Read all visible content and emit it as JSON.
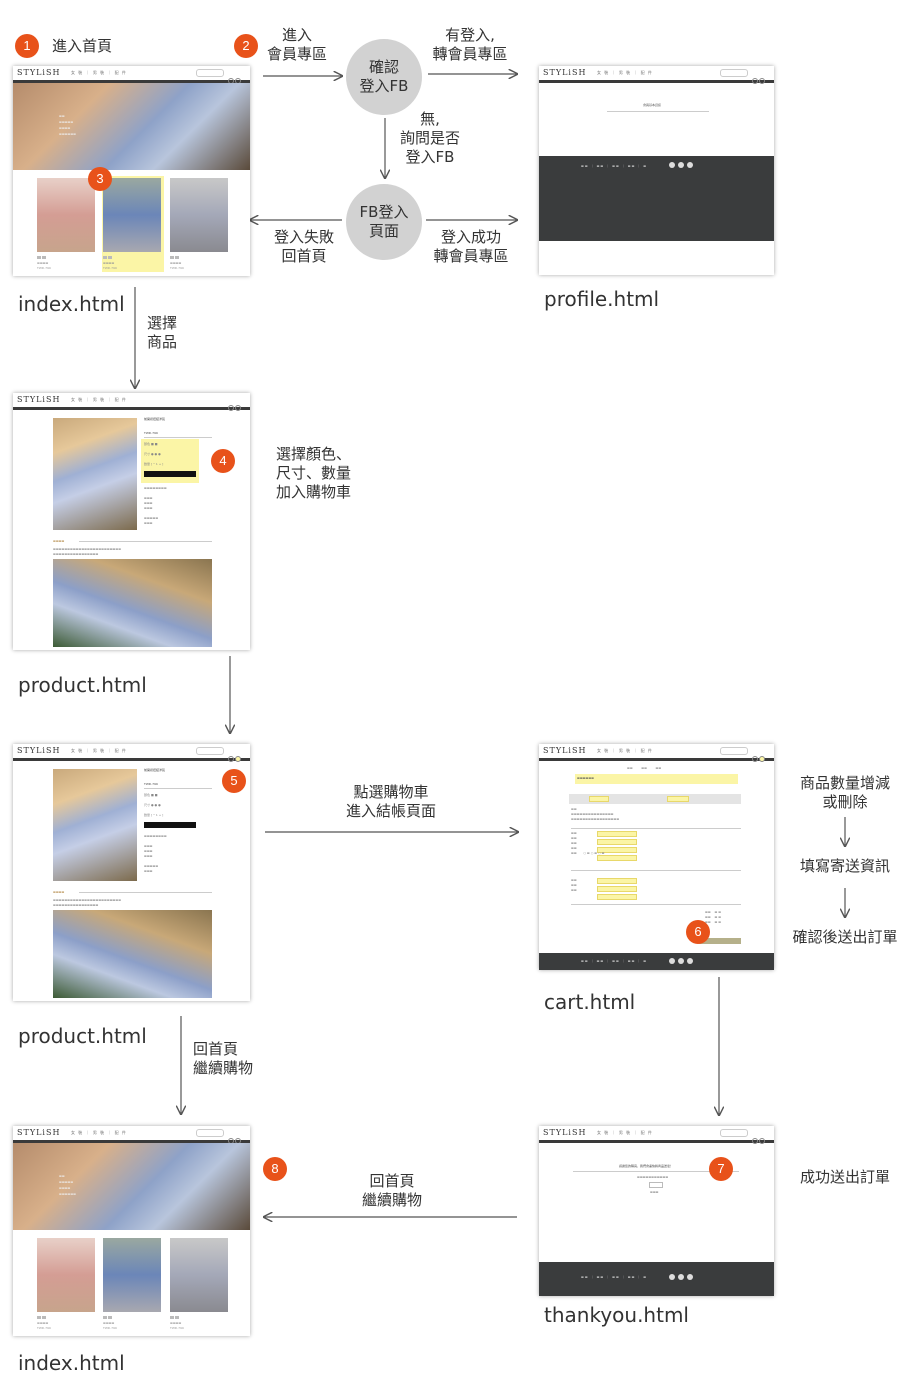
{
  "steps": {
    "s1": {
      "num": "1",
      "label": "進入首頁"
    },
    "s2": {
      "num": "2",
      "label": "進入\n會員專區"
    },
    "s3": {
      "num": "3"
    },
    "s4": {
      "num": "4",
      "label": "選擇顏色、\n尺寸、數量\n加入購物車"
    },
    "s5": {
      "num": "5"
    },
    "s6": {
      "num": "6"
    },
    "s7": {
      "num": "7"
    },
    "s8": {
      "num": "8"
    }
  },
  "decisions": {
    "confirm_fb": "確認\n登入FB",
    "fb_login_page": "FB登入\n頁面"
  },
  "edges": {
    "logged_in": "有登入,\n轉會員專區",
    "not_logged_in": "無,\n詢問是否\n登入FB",
    "login_failed": "登入失敗\n回首頁",
    "login_success": "登入成功\n轉會員專區",
    "select_product": "選擇\n商品",
    "click_cart": "點選購物車\n進入結帳頁面",
    "back_home_1": "回首頁\n繼續購物",
    "back_home_2": "回首頁\n繼續購物"
  },
  "cart_steps": [
    "商品數量增減\n或刪除",
    "填寫寄送資訊",
    "確認後送出訂單"
  ],
  "success_label": "成功送出訂單",
  "files": {
    "index_1": "index.html",
    "profile": "profile.html",
    "product_1": "product.html",
    "product_2": "product.html",
    "cart": "cart.html",
    "index_2": "index.html",
    "thankyou": "thankyou.html"
  },
  "mock": {
    "logo": "STYLiSH",
    "nav": "女 裝 ｜ 男 裝 ｜ 配 件",
    "price": "TWD.799",
    "product_title": "前開衩扭結洋裝",
    "thankyou_text": "感謝您的購買，我們會盡快將商品送達！",
    "profile_title": "會員基本資訊"
  },
  "colors": {
    "accent": "#e8521a",
    "highlight": "#fbf5a6",
    "footer": "#3a3c3d",
    "node": "#d2d2d2"
  }
}
